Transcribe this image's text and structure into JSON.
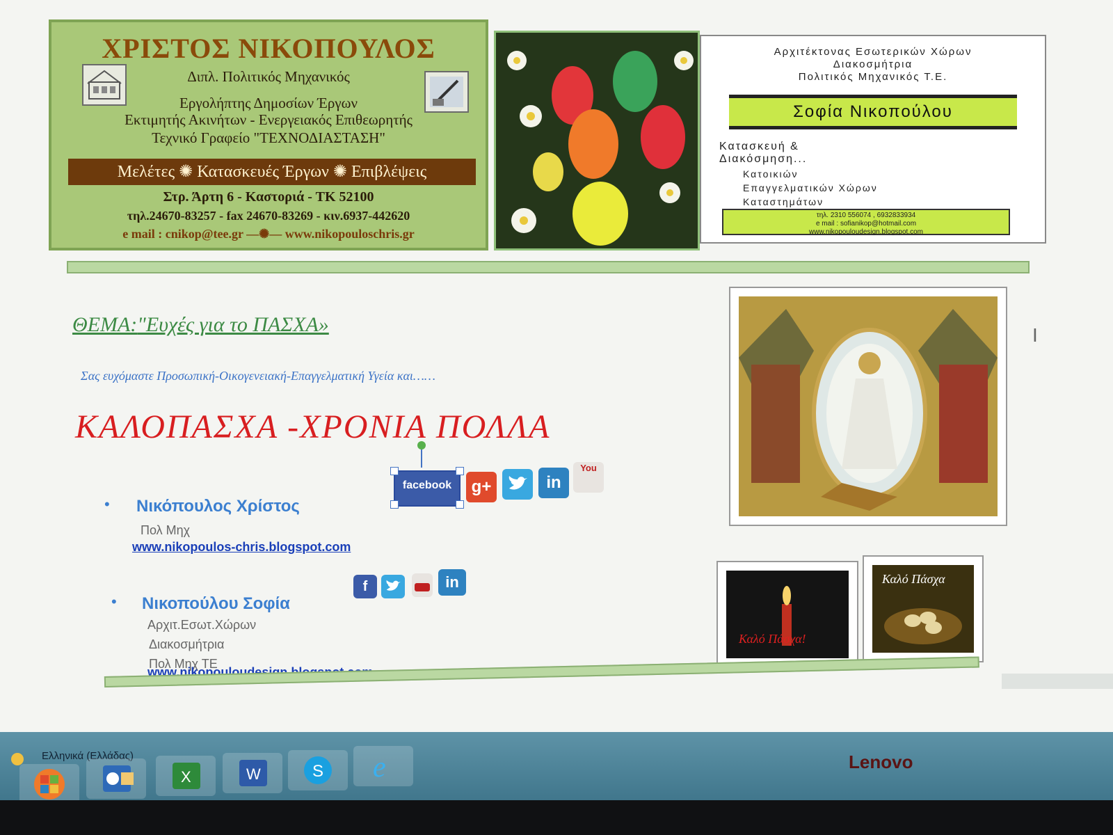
{
  "card1": {
    "name": "ΧΡΙΣΤΟΣ ΝΙΚΟΠΟΥΛΟΣ",
    "title": "Διπλ. Πολιτικός Μηχανικός",
    "line1": "Εργολήπτης Δημοσίων Έργων",
    "line2": "Εκτιμητής Ακινήτων - Ενεργειακός Επιθεωρητής",
    "line3": "Τεχνικό Γραφείο \"ΤΕΧΝΟΔΙΑΣΤΑΣΗ\"",
    "band": "Μελέτες ✺ Κατασκευές Έργων ✺ Επιβλέψεις",
    "address": "Στρ. Άρτη 6 - Καστοριά - ΤΚ 52100",
    "phones": "τηλ.24670-83257 - fax 24670-83269 - κιν.6937-442620",
    "web": "e mail : cnikop@tee.gr —✺— www.nikopouloschris.gr"
  },
  "card3": {
    "line1": "Αρχιτέκτονας Εσωτερικών Χώρων",
    "line2": "Διακοσμήτρια",
    "line3": "Πολιτικός Μηχανικός Τ.Ε.",
    "name": "Σοφία Νικοπούλου",
    "build1": "Κατασκευή &",
    "build2": "Διακόσμηση...",
    "item1": "Κατοικιών",
    "item2": "Επαγγελματικών Χώρων",
    "item3": "Καταστημάτων",
    "foot1": "τηλ. 2310 556074 , 6932833934",
    "foot2": "e mail : sofianikop@hotmail.com",
    "foot3": "www.nikopouloudesign.blogspot.com"
  },
  "doc": {
    "theme_prefix": "ΘΕΜΑ:",
    "theme": "\"Ευχές για το ΠΑΣΧΑ»",
    "wish": "Σας ευχόμαστε Προσωπική-Οικογενειακή-Επαγγελματική Υγεία και……",
    "greeting": "ΚΑΛΟΠΑΣΧΑ -ΧΡΟΝΙΑ ΠΟΛΛΑ",
    "person1": {
      "name": "Νικόπουλος Χρίστος",
      "role": "Πολ Μηχ",
      "link": "www.nikopoulos-chris.blogspot.com"
    },
    "person2": {
      "name": "Νικοπούλου Σοφία",
      "role1": "Αρχιτ.Εσωτ.Χώρων",
      "role2": "Διακοσμήτρια",
      "role3": "Πολ Μηχ ΤΕ",
      "link": "www.nikopouloudesign.blogspot.com"
    }
  },
  "social": {
    "facebook": "facebook",
    "gplus": "g+",
    "linkedin": "in",
    "youtube": "You"
  },
  "pictures": {
    "candle_text": "Καλό Πάσχα!",
    "nest_text": "Καλό Πάσχα"
  },
  "taskbar": {
    "language": "Ελληνικά (Ελλάδας)",
    "brand": "Lenovo"
  },
  "icons": [
    "house-icon",
    "drawing-tool-icon",
    "outlook-icon",
    "excel-icon",
    "word-icon",
    "skype-icon",
    "internet-explorer-icon",
    "windows-start-icon"
  ]
}
